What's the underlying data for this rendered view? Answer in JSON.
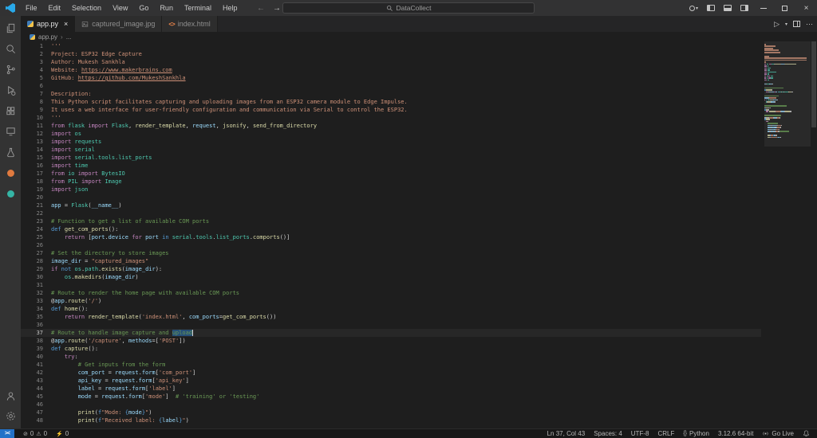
{
  "colors": {
    "accent": "#2472c8",
    "editor_background": "#1e1e1e",
    "titlebar_background": "#323233",
    "selection": "#264f78",
    "comment": "#6a9955",
    "string": "#ce9178",
    "keyword": "#c586c0",
    "keyword_blue": "#569cd6",
    "function": "#dcdcaa",
    "class": "#4ec9b0",
    "variable": "#9cdcfe"
  },
  "glyphs": {
    "back": "←",
    "forward": "→",
    "close": "×",
    "more": "⋯",
    "play": "▷",
    "caret": "▾",
    "chevron": "›",
    "ellipsis": "...",
    "error": "⊘",
    "warning": "⚠",
    "lightning": "⚡",
    "braces": "{}",
    "remote": "><",
    "html_code": "<>"
  },
  "title_bar": {
    "menus": [
      "File",
      "Edit",
      "Selection",
      "View",
      "Go",
      "Run",
      "Terminal",
      "Help"
    ],
    "command_center": "DataCollect"
  },
  "activity_bar": {
    "top_icons": [
      "explorer",
      "search",
      "source-control",
      "run-debug",
      "extensions",
      "remote-explorer",
      "testing",
      "jupyter",
      "docker"
    ],
    "bottom_icons": [
      "account",
      "settings"
    ]
  },
  "tab_bar": {
    "tabs": [
      {
        "label": "app.py",
        "icon": "python",
        "active": true
      },
      {
        "label": "captured_image.jpg",
        "icon": "image",
        "active": false
      },
      {
        "label": "index.html",
        "icon": "html",
        "active": false
      }
    ]
  },
  "breadcrumb": {
    "file": "app.py",
    "ellipsis": "..."
  },
  "editor": {
    "active_line": 37,
    "lines": [
      {
        "n": 1,
        "t": [
          [
            "st",
            "'''"
          ]
        ]
      },
      {
        "n": 2,
        "t": [
          [
            "st",
            "Project: ESP32 Edge Capture"
          ]
        ]
      },
      {
        "n": 3,
        "t": [
          [
            "st",
            "Author: Mukesh Sankhla"
          ]
        ]
      },
      {
        "n": 4,
        "t": [
          [
            "st",
            "Website: "
          ],
          [
            "lk",
            "https://www.makerbrains.com"
          ]
        ]
      },
      {
        "n": 5,
        "t": [
          [
            "st",
            "GitHub: "
          ],
          [
            "lk",
            "https://github.com/MukeshSankhla"
          ]
        ]
      },
      {
        "n": 6,
        "t": []
      },
      {
        "n": 7,
        "t": [
          [
            "st",
            "Description:"
          ]
        ]
      },
      {
        "n": 8,
        "t": [
          [
            "st",
            "This Python script facilitates capturing and uploading images from an ESP32 camera module to Edge Impulse."
          ]
        ]
      },
      {
        "n": 9,
        "t": [
          [
            "st",
            "It uses a web interface for user-friendly configuration and communication via Serial to control the ESP32."
          ]
        ]
      },
      {
        "n": 10,
        "t": [
          [
            "st",
            "'''"
          ]
        ]
      },
      {
        "n": 11,
        "t": [
          [
            "kw",
            "from"
          ],
          [
            "tx",
            " "
          ],
          [
            "cl",
            "flask"
          ],
          [
            "tx",
            " "
          ],
          [
            "kw",
            "import"
          ],
          [
            "tx",
            " "
          ],
          [
            "cl",
            "Flask"
          ],
          [
            "tx",
            ", "
          ],
          [
            "fn",
            "render_template"
          ],
          [
            "tx",
            ", "
          ],
          [
            "vr",
            "request"
          ],
          [
            "tx",
            ", "
          ],
          [
            "fn",
            "jsonify"
          ],
          [
            "tx",
            ", "
          ],
          [
            "fn",
            "send_from_directory"
          ]
        ]
      },
      {
        "n": 12,
        "t": [
          [
            "kw",
            "import"
          ],
          [
            "tx",
            " "
          ],
          [
            "cl",
            "os"
          ]
        ]
      },
      {
        "n": 13,
        "t": [
          [
            "kw",
            "import"
          ],
          [
            "tx",
            " "
          ],
          [
            "cl",
            "requests"
          ]
        ]
      },
      {
        "n": 14,
        "t": [
          [
            "kw",
            "import"
          ],
          [
            "tx",
            " "
          ],
          [
            "cl",
            "serial"
          ]
        ]
      },
      {
        "n": 15,
        "t": [
          [
            "kw",
            "import"
          ],
          [
            "tx",
            " "
          ],
          [
            "cl",
            "serial.tools.list_ports"
          ]
        ]
      },
      {
        "n": 16,
        "t": [
          [
            "kw",
            "import"
          ],
          [
            "tx",
            " "
          ],
          [
            "cl",
            "time"
          ]
        ]
      },
      {
        "n": 17,
        "t": [
          [
            "kw",
            "from"
          ],
          [
            "tx",
            " "
          ],
          [
            "cl",
            "io"
          ],
          [
            "tx",
            " "
          ],
          [
            "kw",
            "import"
          ],
          [
            "tx",
            " "
          ],
          [
            "cl",
            "BytesIO"
          ]
        ]
      },
      {
        "n": 18,
        "t": [
          [
            "kw",
            "from"
          ],
          [
            "tx",
            " "
          ],
          [
            "cl",
            "PIL"
          ],
          [
            "tx",
            " "
          ],
          [
            "kw",
            "import"
          ],
          [
            "tx",
            " "
          ],
          [
            "cl",
            "Image"
          ]
        ]
      },
      {
        "n": 19,
        "t": [
          [
            "kw",
            "import"
          ],
          [
            "tx",
            " "
          ],
          [
            "cl",
            "json"
          ]
        ]
      },
      {
        "n": 20,
        "t": []
      },
      {
        "n": 21,
        "t": [
          [
            "vr",
            "app"
          ],
          [
            "tx",
            " = "
          ],
          [
            "cl",
            "Flask"
          ],
          [
            "tx",
            "("
          ],
          [
            "vr",
            "__name__"
          ],
          [
            "tx",
            ")"
          ]
        ]
      },
      {
        "n": 22,
        "t": []
      },
      {
        "n": 23,
        "t": [
          [
            "cm",
            "# Function to get a list of available COM ports"
          ]
        ]
      },
      {
        "n": 24,
        "t": [
          [
            "kb",
            "def"
          ],
          [
            "tx",
            " "
          ],
          [
            "fn",
            "get_com_ports"
          ],
          [
            "tx",
            "():"
          ]
        ]
      },
      {
        "n": 25,
        "t": [
          [
            "tx",
            "    "
          ],
          [
            "kw",
            "return"
          ],
          [
            "tx",
            " ["
          ],
          [
            "vr",
            "port"
          ],
          [
            "tx",
            "."
          ],
          [
            "vr",
            "device"
          ],
          [
            "tx",
            " "
          ],
          [
            "kw",
            "for"
          ],
          [
            "tx",
            " "
          ],
          [
            "vr",
            "port"
          ],
          [
            "tx",
            " "
          ],
          [
            "kb",
            "in"
          ],
          [
            "tx",
            " "
          ],
          [
            "cl",
            "serial"
          ],
          [
            "tx",
            "."
          ],
          [
            "cl",
            "tools"
          ],
          [
            "tx",
            "."
          ],
          [
            "cl",
            "list_ports"
          ],
          [
            "tx",
            "."
          ],
          [
            "fn",
            "comports"
          ],
          [
            "tx",
            "()]"
          ]
        ]
      },
      {
        "n": 26,
        "t": []
      },
      {
        "n": 27,
        "t": [
          [
            "cm",
            "# Set the directory to store images"
          ]
        ]
      },
      {
        "n": 28,
        "t": [
          [
            "vr",
            "image_dir"
          ],
          [
            "tx",
            " = "
          ],
          [
            "st",
            "\"captured_images\""
          ]
        ]
      },
      {
        "n": 29,
        "t": [
          [
            "kw",
            "if"
          ],
          [
            "tx",
            " "
          ],
          [
            "kb",
            "not"
          ],
          [
            "tx",
            " "
          ],
          [
            "cl",
            "os"
          ],
          [
            "tx",
            "."
          ],
          [
            "cl",
            "path"
          ],
          [
            "tx",
            "."
          ],
          [
            "fn",
            "exists"
          ],
          [
            "tx",
            "("
          ],
          [
            "vr",
            "image_dir"
          ],
          [
            "tx",
            "):"
          ]
        ]
      },
      {
        "n": 30,
        "t": [
          [
            "tx",
            "    "
          ],
          [
            "cl",
            "os"
          ],
          [
            "tx",
            "."
          ],
          [
            "fn",
            "makedirs"
          ],
          [
            "tx",
            "("
          ],
          [
            "vr",
            "image_dir"
          ],
          [
            "tx",
            ")"
          ]
        ]
      },
      {
        "n": 31,
        "t": []
      },
      {
        "n": 32,
        "t": [
          [
            "cm",
            "# Route to render the home page with available COM ports"
          ]
        ]
      },
      {
        "n": 33,
        "t": [
          [
            "tx",
            "@"
          ],
          [
            "vr",
            "app"
          ],
          [
            "tx",
            "."
          ],
          [
            "fn",
            "route"
          ],
          [
            "tx",
            "("
          ],
          [
            "st",
            "'/'"
          ],
          [
            "tx",
            ")"
          ]
        ]
      },
      {
        "n": 34,
        "t": [
          [
            "kb",
            "def"
          ],
          [
            "tx",
            " "
          ],
          [
            "fn",
            "home"
          ],
          [
            "tx",
            "():"
          ]
        ]
      },
      {
        "n": 35,
        "t": [
          [
            "tx",
            "    "
          ],
          [
            "kw",
            "return"
          ],
          [
            "tx",
            " "
          ],
          [
            "fn",
            "render_template"
          ],
          [
            "tx",
            "("
          ],
          [
            "st",
            "'index.html'"
          ],
          [
            "tx",
            ", "
          ],
          [
            "vr",
            "com_ports"
          ],
          [
            "tx",
            "="
          ],
          [
            "fn",
            "get_com_ports"
          ],
          [
            "tx",
            "())"
          ]
        ]
      },
      {
        "n": 36,
        "t": []
      },
      {
        "n": 37,
        "t": [
          [
            "cm",
            "# Route to handle image capture and "
          ],
          [
            "cm",
            "upload",
            "sel"
          ]
        ]
      },
      {
        "n": 38,
        "t": [
          [
            "tx",
            "@"
          ],
          [
            "vr",
            "app"
          ],
          [
            "tx",
            "."
          ],
          [
            "fn",
            "route"
          ],
          [
            "tx",
            "("
          ],
          [
            "st",
            "'/capture'"
          ],
          [
            "tx",
            ", "
          ],
          [
            "vr",
            "methods"
          ],
          [
            "tx",
            "=["
          ],
          [
            "st",
            "'POST'"
          ],
          [
            "tx",
            "])"
          ]
        ]
      },
      {
        "n": 39,
        "t": [
          [
            "kb",
            "def"
          ],
          [
            "tx",
            " "
          ],
          [
            "fn",
            "capture"
          ],
          [
            "tx",
            "():"
          ]
        ]
      },
      {
        "n": 40,
        "t": [
          [
            "tx",
            "    "
          ],
          [
            "kw",
            "try"
          ],
          [
            "tx",
            ":"
          ]
        ]
      },
      {
        "n": 41,
        "t": [
          [
            "tx",
            "        "
          ],
          [
            "cm",
            "# Get inputs from the form"
          ]
        ]
      },
      {
        "n": 42,
        "t": [
          [
            "tx",
            "        "
          ],
          [
            "vr",
            "com_port"
          ],
          [
            "tx",
            " = "
          ],
          [
            "vr",
            "request"
          ],
          [
            "tx",
            "."
          ],
          [
            "vr",
            "form"
          ],
          [
            "tx",
            "["
          ],
          [
            "st",
            "'com_port'"
          ],
          [
            "tx",
            "]"
          ]
        ]
      },
      {
        "n": 43,
        "t": [
          [
            "tx",
            "        "
          ],
          [
            "vr",
            "api_key"
          ],
          [
            "tx",
            " = "
          ],
          [
            "vr",
            "request"
          ],
          [
            "tx",
            "."
          ],
          [
            "vr",
            "form"
          ],
          [
            "tx",
            "["
          ],
          [
            "st",
            "'api_key'"
          ],
          [
            "tx",
            "]"
          ]
        ]
      },
      {
        "n": 44,
        "t": [
          [
            "tx",
            "        "
          ],
          [
            "vr",
            "label"
          ],
          [
            "tx",
            " = "
          ],
          [
            "vr",
            "request"
          ],
          [
            "tx",
            "."
          ],
          [
            "vr",
            "form"
          ],
          [
            "tx",
            "["
          ],
          [
            "st",
            "'label'"
          ],
          [
            "tx",
            "]"
          ]
        ]
      },
      {
        "n": 45,
        "t": [
          [
            "tx",
            "        "
          ],
          [
            "vr",
            "mode"
          ],
          [
            "tx",
            " = "
          ],
          [
            "vr",
            "request"
          ],
          [
            "tx",
            "."
          ],
          [
            "vr",
            "form"
          ],
          [
            "tx",
            "["
          ],
          [
            "st",
            "'mode'"
          ],
          [
            "tx",
            "]  "
          ],
          [
            "cm",
            "# 'training' or 'testing'"
          ]
        ]
      },
      {
        "n": 46,
        "t": []
      },
      {
        "n": 47,
        "t": [
          [
            "tx",
            "        "
          ],
          [
            "fn",
            "print"
          ],
          [
            "tx",
            "("
          ],
          [
            "kb",
            "f"
          ],
          [
            "st",
            "\"Mode: "
          ],
          [
            "kb",
            "{"
          ],
          [
            "vr",
            "mode"
          ],
          [
            "kb",
            "}"
          ],
          [
            "st",
            "\""
          ],
          [
            "tx",
            ")"
          ]
        ]
      },
      {
        "n": 48,
        "t": [
          [
            "tx",
            "        "
          ],
          [
            "fn",
            "print"
          ],
          [
            "tx",
            "("
          ],
          [
            "kb",
            "f"
          ],
          [
            "st",
            "\"Received label: "
          ],
          [
            "kb",
            "{"
          ],
          [
            "vr",
            "label"
          ],
          [
            "kb",
            "}"
          ],
          [
            "st",
            "\""
          ],
          [
            "tx",
            ")"
          ]
        ]
      }
    ]
  },
  "status_bar": {
    "errors": "0",
    "warnings": "0",
    "ports": "0",
    "cursor": "Ln 37, Col 43",
    "indent": "Spaces: 4",
    "encoding": "UTF-8",
    "eol": "CRLF",
    "language": "Python",
    "python_version": "3.12.6 64-bit",
    "go_live": "Go Live"
  }
}
